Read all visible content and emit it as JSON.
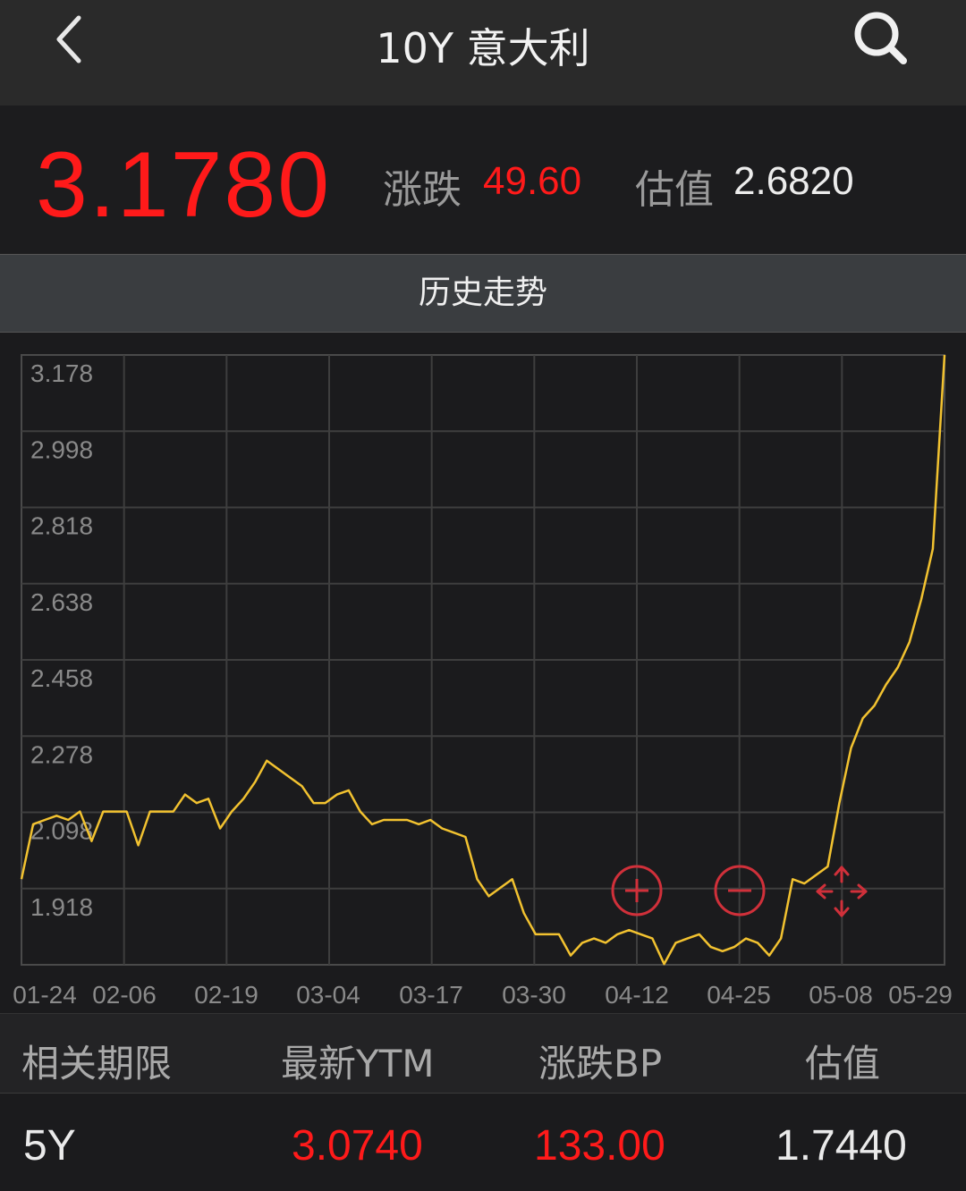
{
  "header": {
    "title": "10Y 意大利",
    "back_icon": "chevron-left-icon",
    "search_icon": "search-icon"
  },
  "quote": {
    "price": "3.1780",
    "change_label": "涨跌",
    "change_value": "49.60",
    "estimate_label": "估值",
    "estimate_value": "2.6820"
  },
  "tab": {
    "label": "历史走势"
  },
  "colors": {
    "up_red": "#ff1a1a",
    "line_yellow": "#f2c230",
    "control_red": "#d0303a"
  },
  "chart_data": {
    "type": "line",
    "title": "",
    "xlabel": "",
    "ylabel": "",
    "x_ticks": [
      "01-24",
      "02-06",
      "02-19",
      "03-04",
      "03-17",
      "03-30",
      "04-12",
      "04-25",
      "05-08",
      "05-29"
    ],
    "y_ticks": [
      "3.178",
      "2.998",
      "2.818",
      "2.638",
      "2.458",
      "2.278",
      "2.098",
      "1.918"
    ],
    "ylim": [
      1.738,
      3.178
    ],
    "grid": true,
    "series": [
      {
        "values": [
          [
            0,
            1.94
          ],
          [
            1,
            2.07
          ],
          [
            2,
            2.08
          ],
          [
            3,
            2.09
          ],
          [
            4,
            2.08
          ],
          [
            5,
            2.1
          ],
          [
            6,
            2.03
          ],
          [
            7,
            2.1
          ],
          [
            8,
            2.1
          ],
          [
            9,
            2.1
          ],
          [
            10,
            2.02
          ],
          [
            11,
            2.1
          ],
          [
            12,
            2.1
          ],
          [
            13,
            2.1
          ],
          [
            14,
            2.14
          ],
          [
            15,
            2.12
          ],
          [
            16,
            2.13
          ],
          [
            17,
            2.06
          ],
          [
            18,
            2.1
          ],
          [
            19,
            2.13
          ],
          [
            20,
            2.17
          ],
          [
            21,
            2.22
          ],
          [
            22,
            2.2
          ],
          [
            23,
            2.18
          ],
          [
            24,
            2.16
          ],
          [
            25,
            2.12
          ],
          [
            26,
            2.12
          ],
          [
            27,
            2.14
          ],
          [
            28,
            2.15
          ],
          [
            29,
            2.1
          ],
          [
            30,
            2.07
          ],
          [
            31,
            2.08
          ],
          [
            32,
            2.08
          ],
          [
            33,
            2.08
          ],
          [
            34,
            2.07
          ],
          [
            35,
            2.08
          ],
          [
            36,
            2.06
          ],
          [
            37,
            2.05
          ],
          [
            38,
            2.04
          ],
          [
            39,
            1.94
          ],
          [
            40,
            1.9
          ],
          [
            41,
            1.92
          ],
          [
            42,
            1.94
          ],
          [
            43,
            1.86
          ],
          [
            44,
            1.81
          ],
          [
            45,
            1.81
          ],
          [
            46,
            1.81
          ],
          [
            47,
            1.76
          ],
          [
            48,
            1.79
          ],
          [
            49,
            1.8
          ],
          [
            50,
            1.79
          ],
          [
            51,
            1.81
          ],
          [
            52,
            1.82
          ],
          [
            53,
            1.81
          ],
          [
            54,
            1.8
          ],
          [
            55,
            1.74
          ],
          [
            56,
            1.79
          ],
          [
            57,
            1.8
          ],
          [
            58,
            1.81
          ],
          [
            59,
            1.78
          ],
          [
            60,
            1.77
          ],
          [
            61,
            1.78
          ],
          [
            62,
            1.8
          ],
          [
            63,
            1.79
          ],
          [
            64,
            1.76
          ],
          [
            65,
            1.8
          ],
          [
            66,
            1.94
          ],
          [
            67,
            1.93
          ],
          [
            68,
            1.95
          ],
          [
            69,
            1.97
          ],
          [
            70,
            2.12
          ],
          [
            71,
            2.25
          ],
          [
            72,
            2.32
          ],
          [
            73,
            2.35
          ],
          [
            74,
            2.4
          ],
          [
            75,
            2.44
          ],
          [
            76,
            2.5
          ],
          [
            77,
            2.6
          ],
          [
            78,
            2.72
          ],
          [
            79,
            3.178
          ]
        ]
      }
    ]
  },
  "controls": {
    "zoom_in_icon": "zoom-in-icon",
    "zoom_out_icon": "zoom-out-icon",
    "pan_icon": "pan-arrows-icon"
  },
  "table": {
    "headers": [
      "相关期限",
      "最新YTM",
      "涨跌BP",
      "估值"
    ],
    "rows": [
      [
        "5Y",
        "3.0740",
        "133.00",
        "1.7440"
      ]
    ]
  }
}
